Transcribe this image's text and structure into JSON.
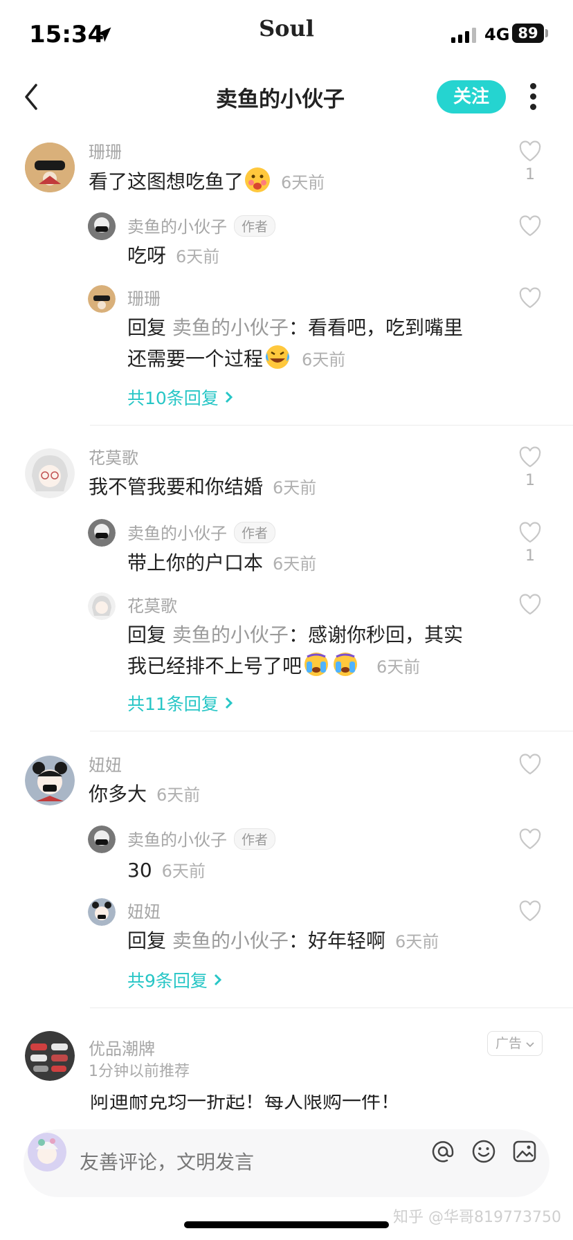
{
  "status_bar": {
    "time": "15:34",
    "carrier_brand": "Soul",
    "network": "4G",
    "battery": "89"
  },
  "header": {
    "title": "卖鱼的小伙子",
    "follow_label": "关注"
  },
  "comments": [
    {
      "name": "珊珊",
      "text": "看了这图想吃鱼了",
      "time": "6天前",
      "likes": "1",
      "replies": [
        {
          "name": "卖鱼的小伙子",
          "badge": "作者",
          "text": "吃呀",
          "time": "6天前"
        },
        {
          "name": "珊珊",
          "prefix": "回复",
          "target": "卖鱼的小伙子",
          "text_line1": "：看看吧，吃到嘴里",
          "text_line2": "还需要一个过程",
          "time": "6天前"
        }
      ],
      "more_replies": "共10条回复"
    },
    {
      "name": "花莫歌",
      "text": "我不管我要和你结婚",
      "time": "6天前",
      "likes": "1",
      "replies": [
        {
          "name": "卖鱼的小伙子",
          "badge": "作者",
          "text": "带上你的户口本",
          "time": "6天前",
          "likes": "1"
        },
        {
          "name": "花莫歌",
          "prefix": "回复",
          "target": "卖鱼的小伙子",
          "text_line1": "：感谢你秒回，其实",
          "text_line2": "我已经排不上号了吧",
          "time": "6天前"
        }
      ],
      "more_replies": "共11条回复"
    },
    {
      "name": "妞妞",
      "text": "你多大",
      "time": "6天前",
      "replies": [
        {
          "name": "卖鱼的小伙子",
          "badge": "作者",
          "text": "30",
          "time": "6天前"
        },
        {
          "name": "妞妞",
          "prefix": "回复",
          "target": "卖鱼的小伙子",
          "text_line1": "：好年轻啊",
          "time": "6天前"
        }
      ],
      "more_replies": "共9条回复"
    }
  ],
  "ad": {
    "name": "优品潮牌",
    "subtitle": "1分钟以前推荐",
    "tag": "广告",
    "text": "阿迪耐克均一折起！每人限购一件！"
  },
  "input": {
    "placeholder": "友善评论，文明发言"
  },
  "watermark": "知乎 @华哥819773750",
  "colors": {
    "accent": "#25d4d0",
    "link": "#27c6c6"
  }
}
